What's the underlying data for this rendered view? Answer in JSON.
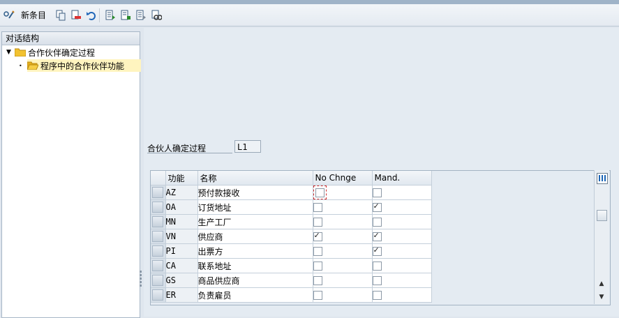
{
  "toolbar": {
    "new_entries_label": "新条目"
  },
  "tree": {
    "header": "对话结构",
    "root": {
      "label": "合作伙伴确定过程"
    },
    "child": {
      "label": "程序中的合作伙伴功能"
    }
  },
  "form": {
    "label": "合伙人确定过程",
    "value": "L1"
  },
  "table": {
    "columns": [
      "功能",
      "名称",
      "No Chnge",
      "Mand."
    ],
    "rows": [
      {
        "code": "AZ",
        "name": "预付款接收",
        "no_change": false,
        "mand": false
      },
      {
        "code": "OA",
        "name": "订货地址",
        "no_change": false,
        "mand": true
      },
      {
        "code": "MN",
        "name": "生产工厂",
        "no_change": false,
        "mand": false
      },
      {
        "code": "VN",
        "name": "供应商",
        "no_change": true,
        "mand": true
      },
      {
        "code": "PI",
        "name": "出票方",
        "no_change": false,
        "mand": true
      },
      {
        "code": "CA",
        "name": "联系地址",
        "no_change": false,
        "mand": false
      },
      {
        "code": "GS",
        "name": "商品供应商",
        "no_change": false,
        "mand": false
      },
      {
        "code": "ER",
        "name": "负责雇员",
        "no_change": false,
        "mand": false
      }
    ]
  },
  "colors": {
    "folder": "#f2c230",
    "selection": "#fff4bf",
    "focus": "#d03030"
  }
}
